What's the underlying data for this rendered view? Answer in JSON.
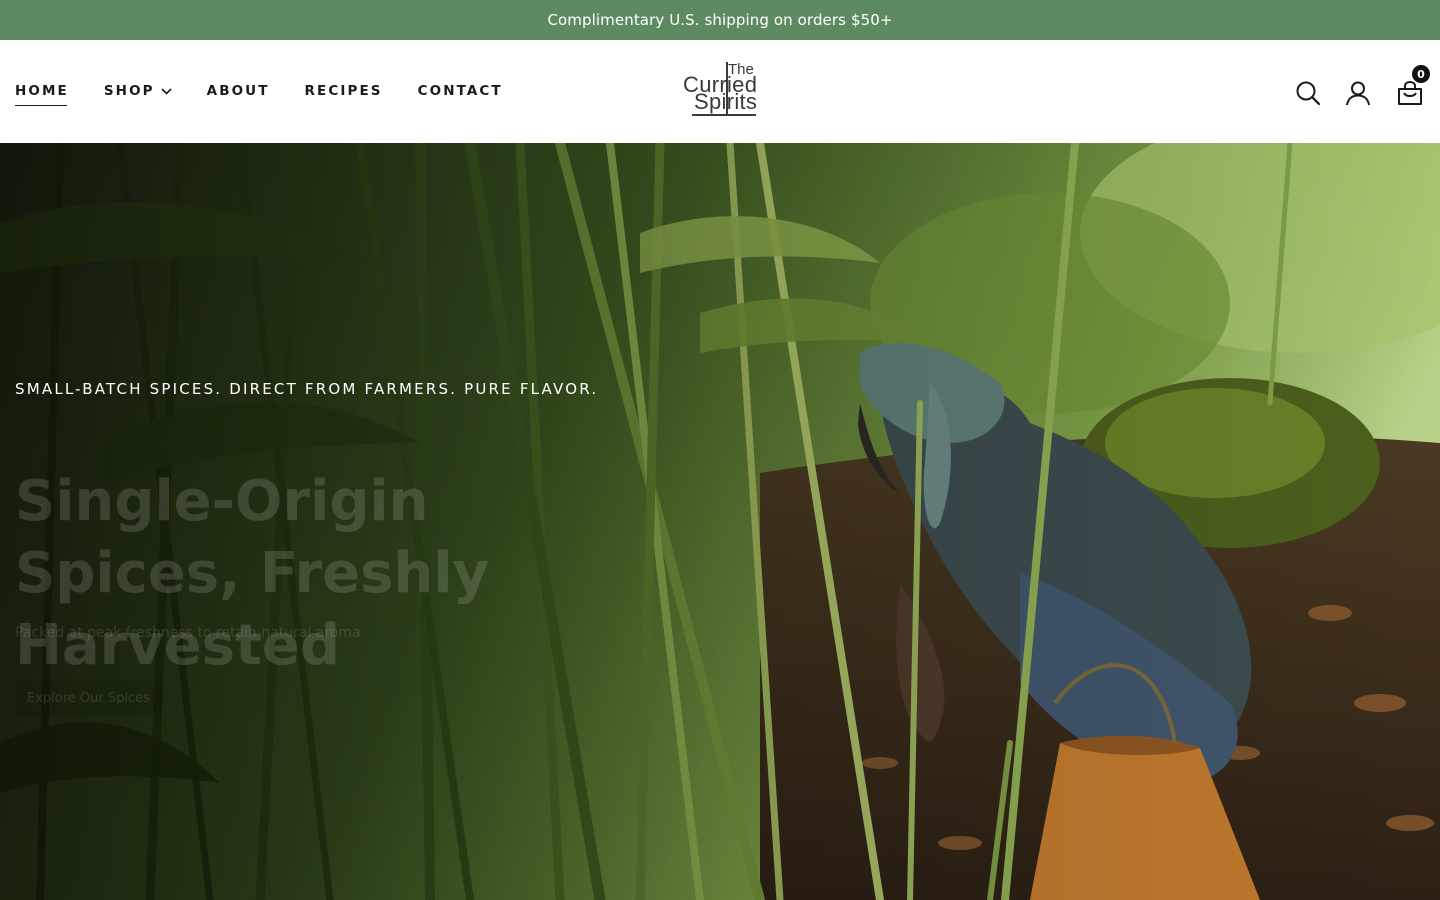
{
  "announcement": {
    "text": "Complimentary U.S. shipping on orders $50+",
    "background": "#5e8a62"
  },
  "nav": {
    "items": [
      {
        "label": "HOME",
        "active": true
      },
      {
        "label": "SHOP",
        "has_dropdown": true
      },
      {
        "label": "ABOUT"
      },
      {
        "label": "RECIPES"
      },
      {
        "label": "CONTACT"
      }
    ]
  },
  "logo": {
    "line1": "The",
    "line2": "Curried",
    "line3": "Spirits"
  },
  "header_icons": {
    "search": "search-icon",
    "account": "user-icon",
    "cart": "cart-icon",
    "cart_count": "0"
  },
  "hero": {
    "kicker": "SMALL-BATCH SPICES. DIRECT FROM FARMERS. PURE FLAVOR.",
    "title": "Single-Origin Spices, Freshly Harvested",
    "subtitle": "Packed at peak freshness to retain natural aroma",
    "cta": "Explore Our Spices"
  }
}
